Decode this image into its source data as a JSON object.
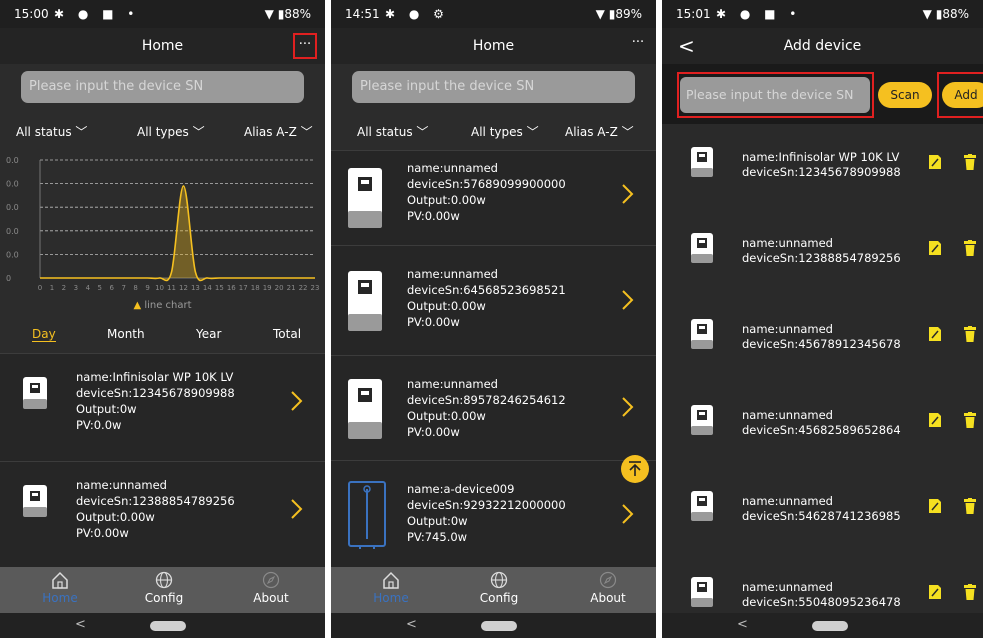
{
  "screens": [
    {
      "status": {
        "time": "15:00",
        "battery": "88%"
      },
      "header": {
        "title": "Home",
        "more_label": "···"
      },
      "search": {
        "placeholder": "Please input the device SN"
      },
      "filters": {
        "status": "All status ﹀",
        "types": "All types ﹀",
        "sort": "Alias A-Z ﹀"
      },
      "chart_data": {
        "type": "line",
        "x": [
          0,
          1,
          2,
          3,
          4,
          5,
          6,
          7,
          8,
          9,
          10,
          11,
          12,
          13,
          14,
          15,
          16,
          17,
          18,
          19,
          20,
          21,
          22,
          23
        ],
        "x_tick_labels": [
          "0",
          "1",
          "2",
          "3",
          "4",
          "5",
          "6",
          "7",
          "8",
          "9",
          "10",
          "11",
          "12",
          "13",
          "14",
          "15",
          "16",
          "17",
          "18",
          "19",
          "20",
          "21",
          "22",
          "23"
        ],
        "y_tick_labels": [
          "0",
          "0.0",
          "0.0",
          "0.0",
          "0.0",
          "0.0"
        ],
        "series": [
          {
            "name": "line chart",
            "values": [
              0,
              0,
              0,
              0,
              0,
              0,
              0,
              0,
              0,
              0,
              0,
              0.05,
              0.78,
              0.05,
              0,
              0,
              0,
              0,
              0,
              0,
              0,
              0,
              0,
              0
            ]
          }
        ],
        "legend": "line chart",
        "legend_position": "bottom",
        "color": "#f5c020",
        "grid": true
      },
      "periods": [
        "Day",
        "Month",
        "Year",
        "Total"
      ],
      "devices": [
        {
          "name": "name:Infinisolar WP 10K LV",
          "sn": "deviceSn:12345678909988",
          "output": "Output:0w",
          "pv": "PV:0.0w"
        },
        {
          "name": "name:unnamed",
          "sn": "deviceSn:12388854789256",
          "output": "Output:0.00w",
          "pv": "PV:0.00w"
        }
      ],
      "nav": {
        "home": "Home",
        "config": "Config",
        "about": "About"
      },
      "sysbar": {
        "back": "<"
      }
    },
    {
      "status": {
        "time": "14:51",
        "battery": "89%"
      },
      "header": {
        "title": "Home",
        "more_label": "···"
      },
      "search": {
        "placeholder": "Please input the device SN"
      },
      "filters": {
        "status": "All status ﹀",
        "types": "All types ﹀",
        "sort": "Alias A-Z ﹀"
      },
      "devices": [
        {
          "name": "name:unnamed",
          "sn": "deviceSn:57689099900000",
          "output": "Output:0.00w",
          "pv": "PV:0.00w"
        },
        {
          "name": "name:unnamed",
          "sn": "deviceSn:64568523698521",
          "output": "Output:0.00w",
          "pv": "PV:0.00w"
        },
        {
          "name": "name:unnamed",
          "sn": "deviceSn:89578246254612",
          "output": "Output:0.00w",
          "pv": "PV:0.00w"
        },
        {
          "name": "name:a-device009",
          "sn": "deviceSn:92932212000000",
          "output": "Output:0w",
          "pv": "PV:745.0w"
        }
      ],
      "nav": {
        "home": "Home",
        "config": "Config",
        "about": "About"
      },
      "sysbar": {
        "back": "<"
      }
    },
    {
      "status": {
        "time": "15:01",
        "battery": "88%"
      },
      "header": {
        "title": "Add device",
        "back_label": "<"
      },
      "add": {
        "placeholder": "Please input the device SN",
        "scan_label": "Scan",
        "add_label": "Add"
      },
      "devices": [
        {
          "name": "name:Infinisolar WP 10K LV",
          "sn": "deviceSn:12345678909988"
        },
        {
          "name": "name:unnamed",
          "sn": "deviceSn:12388854789256"
        },
        {
          "name": "name:unnamed",
          "sn": "deviceSn:45678912345678"
        },
        {
          "name": "name:unnamed",
          "sn": "deviceSn:45682589652864"
        },
        {
          "name": "name:unnamed",
          "sn": "deviceSn:54628741236985"
        },
        {
          "name": "name:unnamed",
          "sn": "deviceSn:55048095236478"
        }
      ],
      "sysbar": {
        "back": "<"
      }
    }
  ],
  "colors": {
    "accent": "#f5c020",
    "background": "#2c2c2c",
    "highlight": "#e02020",
    "nav_active": "#3a72c0"
  }
}
